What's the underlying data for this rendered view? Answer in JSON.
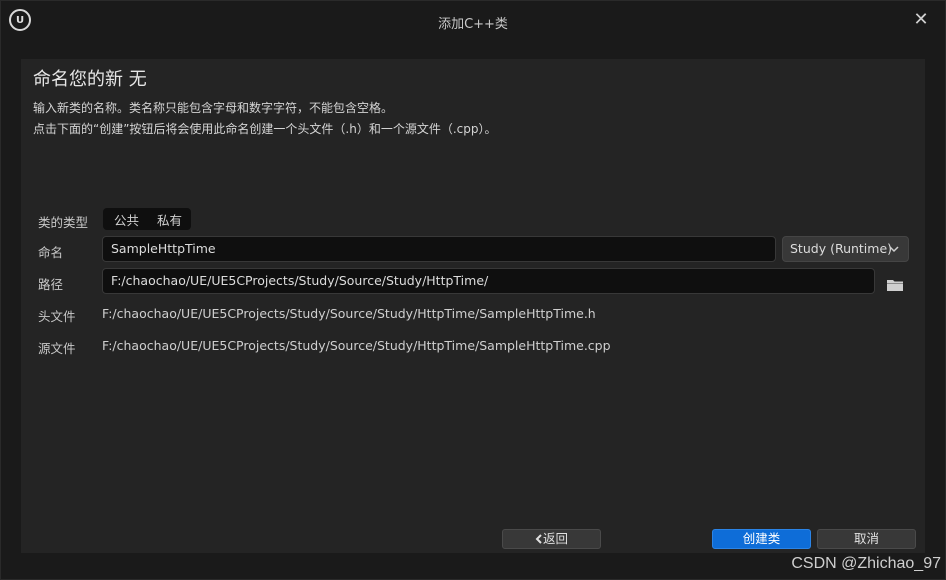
{
  "window": {
    "title": "添加C++类",
    "logo_text": "U"
  },
  "panel": {
    "heading": "命名您的新 无",
    "description_line1": "输入新类的名称。类名称只能包含字母和数字字符，不能包含空格。",
    "description_line2": "点击下面的“创建”按钮后将会使用此命名创建一个头文件（.h）和一个源文件（.cpp）。"
  },
  "form": {
    "class_type_label": "类的类型",
    "class_type_options": [
      "公共",
      "私有"
    ],
    "name_label": "命名",
    "name_value": "SampleHttpTime",
    "module_dropdown": "Study (Runtime)",
    "path_label": "路径",
    "path_value": "F:/chaochao/UE/UE5CProjects/Study/Source/Study/HttpTime/",
    "header_label": "头文件",
    "header_value": "F:/chaochao/UE/UE5CProjects/Study/Source/Study/HttpTime/SampleHttpTime.h",
    "source_label": "源文件",
    "source_value": "F:/chaochao/UE/UE5CProjects/Study/Source/Study/HttpTime/SampleHttpTime.cpp"
  },
  "buttons": {
    "back": "返回",
    "create": "创建类",
    "cancel": "取消"
  },
  "icons": {
    "close": "close-icon",
    "folder": "folder-icon",
    "chevron": "chevron-down-icon",
    "back_arrow": "chevron-left-icon"
  },
  "colors": {
    "accent": "#0e6dd8",
    "background": "#1a1a1a",
    "panel": "#242424"
  },
  "watermark": "CSDN @Zhichao_97"
}
